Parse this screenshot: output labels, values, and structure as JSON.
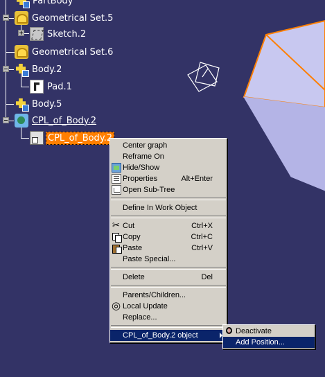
{
  "tree": {
    "nodes": [
      {
        "label": "PartBody",
        "icon": "body-icon"
      },
      {
        "label": "Geometrical Set.5",
        "icon": "geometrical-set-icon"
      },
      {
        "label": "Sketch.2",
        "icon": "sketch-icon"
      },
      {
        "label": "Geometrical Set.6",
        "icon": "geometrical-set-icon"
      },
      {
        "label": "Body.2",
        "icon": "body-icon"
      },
      {
        "label": "Pad.1",
        "icon": "pad-icon"
      },
      {
        "label": "Body.5",
        "icon": "body-icon"
      },
      {
        "label": "CPL_of_Body.2",
        "icon": "cpl-icon"
      },
      {
        "label": "CPL_of_Body.2",
        "icon": "cpl-object-icon",
        "selected": true
      }
    ]
  },
  "context_menu": {
    "items": [
      {
        "label": "Center graph"
      },
      {
        "label": "Reframe On"
      },
      {
        "label": "Hide/Show",
        "icon": "hide-show-icon"
      },
      {
        "label": "Properties",
        "accel": "Alt+Enter",
        "icon": "properties-icon"
      },
      {
        "label": "Open Sub-Tree",
        "icon": "subtree-icon"
      },
      {
        "label": "Define In Work Object"
      },
      {
        "label": "Cut",
        "accel": "Ctrl+X",
        "icon": "cut-icon"
      },
      {
        "label": "Copy",
        "accel": "Ctrl+C",
        "icon": "copy-icon"
      },
      {
        "label": "Paste",
        "accel": "Ctrl+V",
        "icon": "paste-icon"
      },
      {
        "label": "Paste Special..."
      },
      {
        "label": "Delete",
        "accel": "Del"
      },
      {
        "label": "Parents/Children..."
      },
      {
        "label": "Local Update",
        "icon": "local-update-icon"
      },
      {
        "label": "Replace..."
      },
      {
        "label": "CPL_of_Body.2 object",
        "submenu": true,
        "highlighted": true
      }
    ]
  },
  "submenu": {
    "items": [
      {
        "label": "Deactivate",
        "icon": "deactivate-icon"
      },
      {
        "label": "Add Position...",
        "highlighted": true
      }
    ]
  },
  "colors": {
    "background": "#333366",
    "selection": "#ff7f00",
    "menu_highlight": "#0a246a",
    "solid_face": "#c8c8f0",
    "solid_edge": "#ff7f00"
  }
}
